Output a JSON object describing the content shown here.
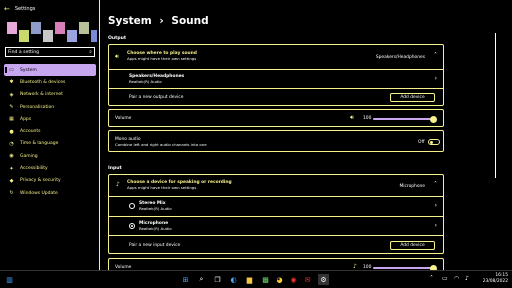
{
  "window": {
    "title": "Settings",
    "back_glyph": "←"
  },
  "search": {
    "placeholder": "Find a setting"
  },
  "profile_colors": [
    "#e6a8d8",
    "#c9d96a",
    "#8f9cc8",
    "#c7c7c7",
    "#d67fb8",
    "#9aa3e0",
    "#b8c19a",
    "#7a8bd6"
  ],
  "sidebar": {
    "items": [
      {
        "label": "System",
        "icon": "monitor-icon",
        "glyph": "▭",
        "active": true
      },
      {
        "label": "Bluetooth & devices",
        "icon": "bluetooth-icon",
        "glyph": "✱"
      },
      {
        "label": "Network & internet",
        "icon": "wifi-icon",
        "glyph": "◈"
      },
      {
        "label": "Personalisation",
        "icon": "brush-icon",
        "glyph": "✎"
      },
      {
        "label": "Apps",
        "icon": "apps-icon",
        "glyph": "▦"
      },
      {
        "label": "Accounts",
        "icon": "person-icon",
        "glyph": "●"
      },
      {
        "label": "Time & language",
        "icon": "globe-clock-icon",
        "glyph": "◔"
      },
      {
        "label": "Gaming",
        "icon": "gamepad-icon",
        "glyph": "◉"
      },
      {
        "label": "Accessibility",
        "icon": "accessibility-icon",
        "glyph": "✦"
      },
      {
        "label": "Privacy & security",
        "icon": "shield-icon",
        "glyph": "◆"
      },
      {
        "label": "Windows Update",
        "icon": "update-icon",
        "glyph": "↻"
      }
    ]
  },
  "breadcrumb": {
    "parent": "System",
    "separator": "›",
    "current": "Sound"
  },
  "output": {
    "section_title": "Output",
    "choose": {
      "title": "Choose where to play sound",
      "subtitle": "Apps might have their own settings",
      "value": "Speakers/Headphones"
    },
    "device": {
      "name": "Speakers/Headphones",
      "driver": "Realtek(R) Audio"
    },
    "pair": {
      "label": "Pair a new output device",
      "button": "Add device"
    },
    "volume": {
      "label": "Volume",
      "value": "100",
      "level": 1.0
    },
    "mono": {
      "title": "Mono audio",
      "subtitle": "Combine left and right audio channels into one",
      "state": "Off"
    }
  },
  "input": {
    "section_title": "Input",
    "choose": {
      "title": "Choose a device for speaking or recording",
      "subtitle": "Apps might have their own settings",
      "value": "Microphone"
    },
    "devices": [
      {
        "name": "Stereo Mix",
        "driver": "Realtek(R) Audio",
        "selected": false
      },
      {
        "name": "Microphone",
        "driver": "Realtek(R) Audio",
        "selected": true
      }
    ],
    "pair": {
      "label": "Pair a new input device",
      "button": "Add device"
    },
    "volume": {
      "label": "Volume",
      "value": "100",
      "level": 1.0
    }
  },
  "taskbar": {
    "time": "16:15",
    "date": "23/08/2022",
    "colors": {
      "accent": "#f6f08a",
      "slider": "#c7a6f0"
    }
  }
}
